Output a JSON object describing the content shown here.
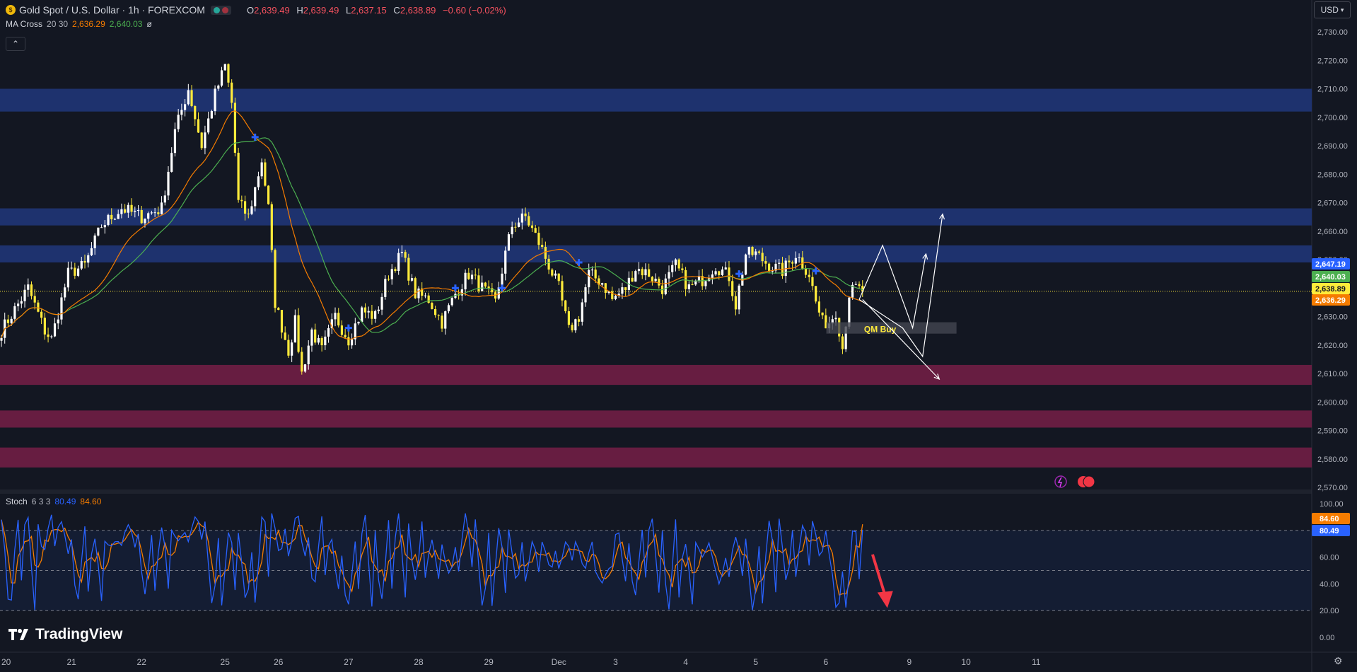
{
  "header": {
    "symbol": "Gold Spot / U.S. Dollar · 1h · FOREXCOM",
    "open_key": "O",
    "open": "2,639.49",
    "high_key": "H",
    "high": "2,639.49",
    "low_key": "L",
    "low": "2,637.15",
    "close_key": "C",
    "close": "2,638.89",
    "change": "−0.60 (−0.02%)",
    "currency": "USD"
  },
  "ma_legend": {
    "name": "MA Cross",
    "params": "20 30",
    "fast": "2,636.29",
    "slow": "2,640.03",
    "extra": "ø"
  },
  "stoch_legend": {
    "name": "Stoch",
    "params": "6 3 3",
    "k": "80.49",
    "d": "84.60"
  },
  "brand": "TradingView",
  "colors": {
    "bg": "#131722",
    "up": "#ffffff",
    "down": "#ffeb3b",
    "ma_fast": "#f57c00",
    "ma_slow": "#4caf50",
    "stoch_k": "#2962ff",
    "stoch_d": "#f57c00",
    "resistance": "#1e3a8a",
    "support": "#6b1d43"
  },
  "chart_data": [
    {
      "type": "candlestick",
      "title": "Gold Spot / U.S. Dollar · 1h · FOREXCOM",
      "x_ticks": [
        {
          "label": "20",
          "idx": 0
        },
        {
          "label": "21",
          "idx": 21
        },
        {
          "label": "22",
          "idx": 42
        },
        {
          "label": "25",
          "idx": 67
        },
        {
          "label": "26",
          "idx": 83
        },
        {
          "label": "27",
          "idx": 104
        },
        {
          "label": "28",
          "idx": 125
        },
        {
          "label": "29",
          "idx": 146
        },
        {
          "label": "Dec",
          "idx": 167
        },
        {
          "label": "3",
          "idx": 184
        },
        {
          "label": "4",
          "idx": 205
        },
        {
          "label": "5",
          "idx": 226
        },
        {
          "label": "6",
          "idx": 247
        },
        {
          "label": "9",
          "idx": 272
        },
        {
          "label": "10",
          "idx": 289
        },
        {
          "label": "11",
          "idx": 310
        }
      ],
      "y_ticks": [
        "2,730.00",
        "2,720.00",
        "2,710.00",
        "2,700.00",
        "2,690.00",
        "2,680.00",
        "2,670.00",
        "2,660.00",
        "2,650.00",
        "2,640.00",
        "2,630.00",
        "2,620.00",
        "2,610.00",
        "2,600.00",
        "2,590.00",
        "2,580.00",
        "2,570.00"
      ],
      "ylim": [
        2570,
        2730
      ],
      "anchors": [
        {
          "i": 0,
          "p": 2625
        },
        {
          "i": 8,
          "p": 2640
        },
        {
          "i": 13,
          "p": 2625
        },
        {
          "i": 15,
          "p": 2622
        },
        {
          "i": 20,
          "p": 2645
        },
        {
          "i": 25,
          "p": 2648
        },
        {
          "i": 30,
          "p": 2662
        },
        {
          "i": 36,
          "p": 2668
        },
        {
          "i": 42,
          "p": 2665
        },
        {
          "i": 48,
          "p": 2668
        },
        {
          "i": 52,
          "p": 2695
        },
        {
          "i": 56,
          "p": 2710
        },
        {
          "i": 60,
          "p": 2690
        },
        {
          "i": 64,
          "p": 2708
        },
        {
          "i": 67,
          "p": 2718
        },
        {
          "i": 69,
          "p": 2705
        },
        {
          "i": 71,
          "p": 2670
        },
        {
          "i": 74,
          "p": 2665
        },
        {
          "i": 78,
          "p": 2685
        },
        {
          "i": 80,
          "p": 2668
        },
        {
          "i": 82,
          "p": 2635
        },
        {
          "i": 86,
          "p": 2618
        },
        {
          "i": 88,
          "p": 2628
        },
        {
          "i": 90,
          "p": 2610
        },
        {
          "i": 93,
          "p": 2625
        },
        {
          "i": 96,
          "p": 2618
        },
        {
          "i": 100,
          "p": 2630
        },
        {
          "i": 104,
          "p": 2622
        },
        {
          "i": 108,
          "p": 2632
        },
        {
          "i": 112,
          "p": 2630
        },
        {
          "i": 116,
          "p": 2645
        },
        {
          "i": 120,
          "p": 2652
        },
        {
          "i": 124,
          "p": 2638
        },
        {
          "i": 128,
          "p": 2636
        },
        {
          "i": 132,
          "p": 2628
        },
        {
          "i": 136,
          "p": 2638
        },
        {
          "i": 140,
          "p": 2645
        },
        {
          "i": 144,
          "p": 2640
        },
        {
          "i": 148,
          "p": 2635
        },
        {
          "i": 151,
          "p": 2652
        },
        {
          "i": 153,
          "p": 2662
        },
        {
          "i": 157,
          "p": 2665
        },
        {
          "i": 161,
          "p": 2656
        },
        {
          "i": 164,
          "p": 2648
        },
        {
          "i": 167,
          "p": 2640
        },
        {
          "i": 170,
          "p": 2625
        },
        {
          "i": 173,
          "p": 2630
        },
        {
          "i": 176,
          "p": 2645
        },
        {
          "i": 180,
          "p": 2642
        },
        {
          "i": 183,
          "p": 2636
        },
        {
          "i": 187,
          "p": 2640
        },
        {
          "i": 190,
          "p": 2647
        },
        {
          "i": 194,
          "p": 2645
        },
        {
          "i": 198,
          "p": 2640
        },
        {
          "i": 202,
          "p": 2648
        },
        {
          "i": 206,
          "p": 2640
        },
        {
          "i": 210,
          "p": 2643
        },
        {
          "i": 214,
          "p": 2648
        },
        {
          "i": 218,
          "p": 2644
        },
        {
          "i": 220,
          "p": 2634
        },
        {
          "i": 223,
          "p": 2652
        },
        {
          "i": 226,
          "p": 2652
        },
        {
          "i": 230,
          "p": 2648
        },
        {
          "i": 234,
          "p": 2646
        },
        {
          "i": 238,
          "p": 2652
        },
        {
          "i": 242,
          "p": 2645
        },
        {
          "i": 244,
          "p": 2635
        },
        {
          "i": 246,
          "p": 2628
        },
        {
          "i": 248,
          "p": 2628
        },
        {
          "i": 250,
          "p": 2632
        },
        {
          "i": 252,
          "p": 2619
        },
        {
          "i": 254,
          "p": 2638
        },
        {
          "i": 256,
          "p": 2640
        },
        {
          "i": 258,
          "p": 2638.89
        }
      ],
      "ma_fast_name": "MA 20",
      "ma_slow_name": "MA 30",
      "zones": [
        {
          "kind": "resistance",
          "from": 2702,
          "to": 2710
        },
        {
          "kind": "resistance",
          "from": 2662,
          "to": 2668
        },
        {
          "kind": "resistance",
          "from": 2649,
          "to": 2655
        },
        {
          "kind": "support",
          "from": 2606,
          "to": 2613
        },
        {
          "kind": "support",
          "from": 2591,
          "to": 2597
        },
        {
          "kind": "support",
          "from": 2577,
          "to": 2584
        }
      ],
      "qm_box": {
        "label": "QM Buy",
        "from_idx": 248,
        "to_idx": 287,
        "from": 2624,
        "to": 2628
      },
      "current_price_line": 2638.89,
      "price_labels": [
        {
          "text": "2,647.19",
          "color": "#2962ff",
          "value": 2647.19
        },
        {
          "text": "2,640.03",
          "color": "#4caf50",
          "value": 2640.03
        },
        {
          "text": "2,638.89",
          "color": "#ffeb3b",
          "value": 2638.89
        },
        {
          "text": "2,636.29",
          "color": "#f57c00",
          "value": 2636.29
        }
      ],
      "cross_markers": [
        {
          "i": 76,
          "p": 2693
        },
        {
          "i": 104,
          "p": 2626
        },
        {
          "i": 136,
          "p": 2640
        },
        {
          "i": 150,
          "p": 2640
        },
        {
          "i": 173,
          "p": 2649
        },
        {
          "i": 221,
          "p": 2645
        },
        {
          "i": 244,
          "p": 2646
        }
      ],
      "projection_paths": [
        [
          {
            "i": 257,
            "p": 2636
          },
          {
            "i": 264,
            "p": 2655
          },
          {
            "i": 273,
            "p": 2626
          },
          {
            "i": 277,
            "p": 2652
          }
        ],
        [
          {
            "i": 257,
            "p": 2636
          },
          {
            "i": 270,
            "p": 2626
          },
          {
            "i": 276,
            "p": 2616
          },
          {
            "i": 282,
            "p": 2666
          }
        ],
        [
          {
            "i": 258,
            "p": 2636
          },
          {
            "i": 281,
            "p": 2608
          }
        ]
      ]
    },
    {
      "type": "line",
      "title": "Stoch 6 3 3",
      "series_names": [
        "%K",
        "%D"
      ],
      "y_ticks": [
        "100.00",
        "80.00",
        "60.00",
        "40.00",
        "20.00",
        "0.00"
      ],
      "ylim": [
        0,
        100
      ],
      "guides": [
        80,
        50,
        20
      ],
      "cycle_peaks": [
        88,
        20,
        92,
        62,
        85,
        25,
        72,
        66,
        82,
        30,
        80,
        70,
        88,
        22,
        78,
        25,
        92,
        60,
        90,
        35,
        72,
        20,
        90,
        25,
        90,
        40,
        70,
        45,
        90,
        20,
        80,
        40,
        70,
        50,
        70,
        50,
        40,
        80,
        30,
        90,
        20,
        70,
        60,
        40,
        75,
        20,
        88,
        42,
        85,
        60,
        20,
        85
      ],
      "current_k": 80.49,
      "current_d": 84.6,
      "labels": [
        {
          "text": "84.60",
          "color": "#f57c00",
          "value": 84.6
        },
        {
          "text": "80.49",
          "color": "#2962ff",
          "value": 80.49
        }
      ],
      "arrow": {
        "from": {
          "i": 261,
          "v": 62
        },
        "to": {
          "i": 265,
          "v": 23
        }
      }
    }
  ]
}
